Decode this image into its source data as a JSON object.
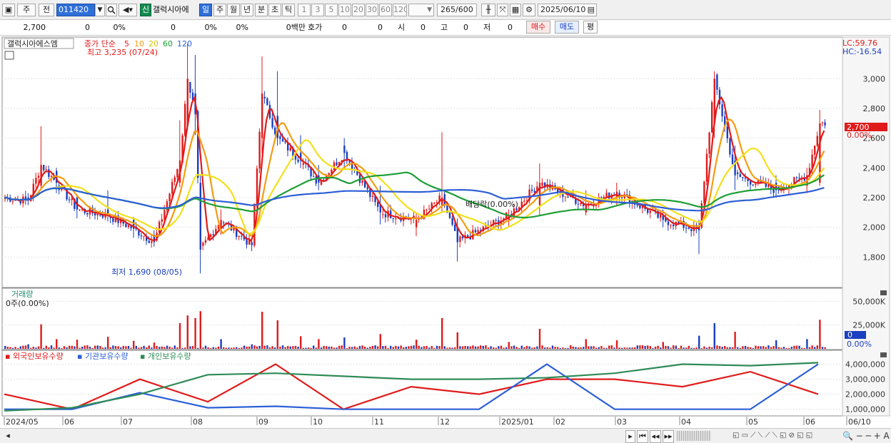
{
  "toolbar": {
    "tab_share": "주",
    "tab_all": "전",
    "code": "011420",
    "new_badge": "신",
    "stock_name": "갤럭시아에",
    "periods": [
      "일",
      "주",
      "월",
      "년",
      "분",
      "초",
      "틱"
    ],
    "intervals": [
      "1",
      "3",
      "5",
      "10",
      "20",
      "30",
      "60",
      "120"
    ],
    "count": "265",
    "count_max": "/600",
    "date": "2025/06/10"
  },
  "quote": {
    "price": "2,700",
    "change": "0",
    "change_pct": "0%",
    "v1": "0",
    "v1_pct": "0%",
    "v2_pct": "0%",
    "amount": "0백만",
    "bid_label": "호가",
    "bid_v1": "0",
    "bid_v2": "0",
    "open_label": "시",
    "open_v": "0",
    "high_label": "고",
    "high_v": "0",
    "low_label": "저",
    "low_v": "0",
    "buy_label": "매수",
    "sell_label": "매도",
    "flat_label": "평"
  },
  "price_panel": {
    "stock_label": "갤럭시아에스엠",
    "ma_title": "종가 단순",
    "ma_periods": [
      "5",
      "10",
      "20",
      "60",
      "120"
    ],
    "ma_colors": [
      "#e01b1b",
      "#f39c12",
      "#f2e01a",
      "#1e9e36",
      "#2d5fd6"
    ],
    "high_note": "최고 3,235 (07/24)",
    "low_note": "최저 1,690 (08/05)",
    "dividend_note": "배당락(0.00%)",
    "lc": "LC:59.76",
    "hc": "HC:-16.54",
    "price_tag": "2,700",
    "pct_tag": "0.00%",
    "y_ticks": [
      "3,000",
      "2,800",
      "2,600",
      "2,400",
      "2,200",
      "2,000",
      "1,800"
    ]
  },
  "volume_panel": {
    "title": "거래량",
    "value": "0주(0.00%)",
    "y_ticks": [
      "50,000K",
      "25,000K"
    ],
    "last_tag": "0",
    "pct_tag": "0.00%"
  },
  "holdings_panel": {
    "series_labels": [
      "외국인보유수량",
      "기관보유수량",
      "개인보유수량"
    ],
    "series_colors": [
      "#e01b1b",
      "#2d5fd6",
      "#2e8b57"
    ],
    "y_ticks": [
      "4,000,000",
      "3,000,000",
      "2,000,000",
      "1,000,000"
    ]
  },
  "x_axis": {
    "labels": [
      "2024/05",
      "06",
      "07",
      "08",
      "09",
      "10",
      "11",
      "12",
      "2025/01",
      "02",
      "03",
      "04",
      "05",
      "06",
      "06/10"
    ]
  },
  "chart_data": {
    "type": "candlestick",
    "price_axis": {
      "ticks": [
        3000,
        2800,
        2600,
        2400,
        2200,
        2000,
        1800
      ],
      "range": [
        1600,
        3280
      ]
    },
    "points": [
      {
        "i": 0,
        "o": 2190,
        "c": 2200,
        "h": 2220,
        "l": 2170
      },
      {
        "i": 9,
        "o": 2200,
        "c": 2180,
        "h": 2230,
        "l": 2150
      },
      {
        "i": 14,
        "o": 2280,
        "c": 2420,
        "h": 2680,
        "l": 2250
      },
      {
        "i": 20,
        "o": 2380,
        "c": 2300,
        "h": 2400,
        "l": 2230
      },
      {
        "i": 28,
        "o": 2200,
        "c": 2120,
        "h": 2220,
        "l": 2060
      },
      {
        "i": 40,
        "o": 2120,
        "c": 2080,
        "h": 2250,
        "l": 2040
      },
      {
        "i": 50,
        "o": 2050,
        "c": 1990,
        "h": 2070,
        "l": 1930
      },
      {
        "i": 58,
        "o": 1950,
        "c": 1900,
        "h": 1980,
        "l": 1870
      },
      {
        "i": 68,
        "o": 2300,
        "c": 2450,
        "h": 2720,
        "l": 2270
      },
      {
        "i": 71,
        "o": 2680,
        "c": 3000,
        "h": 3235,
        "l": 2650
      },
      {
        "i": 74,
        "o": 2900,
        "c": 2760,
        "h": 3160,
        "l": 2620
      },
      {
        "i": 76,
        "o": 2300,
        "c": 1850,
        "h": 2350,
        "l": 1690
      },
      {
        "i": 84,
        "o": 2000,
        "c": 2050,
        "h": 2120,
        "l": 1950
      },
      {
        "i": 96,
        "o": 1900,
        "c": 1880,
        "h": 1920,
        "l": 1840
      },
      {
        "i": 100,
        "o": 2600,
        "c": 2900,
        "h": 3150,
        "l": 2500
      },
      {
        "i": 106,
        "o": 2750,
        "c": 2600,
        "h": 3050,
        "l": 2550
      },
      {
        "i": 115,
        "o": 2500,
        "c": 2450,
        "h": 2620,
        "l": 2400
      },
      {
        "i": 122,
        "o": 2350,
        "c": 2300,
        "h": 2420,
        "l": 2250
      },
      {
        "i": 132,
        "o": 2550,
        "c": 2500,
        "h": 2600,
        "l": 2400
      },
      {
        "i": 146,
        "o": 2150,
        "c": 2100,
        "h": 2280,
        "l": 2020
      },
      {
        "i": 160,
        "o": 2000,
        "c": 2050,
        "h": 2100,
        "l": 1940
      },
      {
        "i": 170,
        "o": 2150,
        "c": 2200,
        "h": 2640,
        "l": 2100
      },
      {
        "i": 176,
        "o": 2000,
        "c": 1900,
        "h": 2060,
        "l": 1770
      },
      {
        "i": 196,
        "o": 2050,
        "c": 2080,
        "h": 2120,
        "l": 2000
      },
      {
        "i": 208,
        "o": 2150,
        "c": 2300,
        "h": 2430,
        "l": 2080
      },
      {
        "i": 226,
        "o": 2100,
        "c": 2150,
        "h": 2250,
        "l": 2080
      },
      {
        "i": 238,
        "o": 2200,
        "c": 2240,
        "h": 2300,
        "l": 2150
      },
      {
        "i": 256,
        "o": 2080,
        "c": 2050,
        "h": 2120,
        "l": 2000
      },
      {
        "i": 270,
        "o": 2000,
        "c": 1980,
        "h": 2050,
        "l": 1820
      },
      {
        "i": 276,
        "o": 2700,
        "c": 3000,
        "h": 3050,
        "l": 2600
      },
      {
        "i": 284,
        "o": 2450,
        "c": 2350,
        "h": 2550,
        "l": 2250
      },
      {
        "i": 300,
        "o": 2300,
        "c": 2250,
        "h": 2350,
        "l": 2200
      },
      {
        "i": 312,
        "o": 2280,
        "c": 2350,
        "h": 2400,
        "l": 2230
      },
      {
        "i": 317,
        "o": 2300,
        "c": 2700,
        "h": 2790,
        "l": 2280
      }
    ],
    "foreign_holdings": [
      2000000,
      1000000,
      3000000,
      1500000,
      4000000,
      1000000,
      2500000,
      2000000,
      3000000,
      3000000,
      2500000,
      3500000,
      2000000
    ],
    "institution_holdings": [
      1000000,
      1000000,
      2100000,
      1100000,
      1200000,
      1000000,
      1000000,
      1000000,
      4000000,
      1000000,
      1000000,
      1000000,
      4000000
    ],
    "individual_holdings": [
      900000,
      1100000,
      2000000,
      3300000,
      3400000,
      3200000,
      3000000,
      3000000,
      3100000,
      3400000,
      4000000,
      3900000,
      4100000
    ]
  }
}
